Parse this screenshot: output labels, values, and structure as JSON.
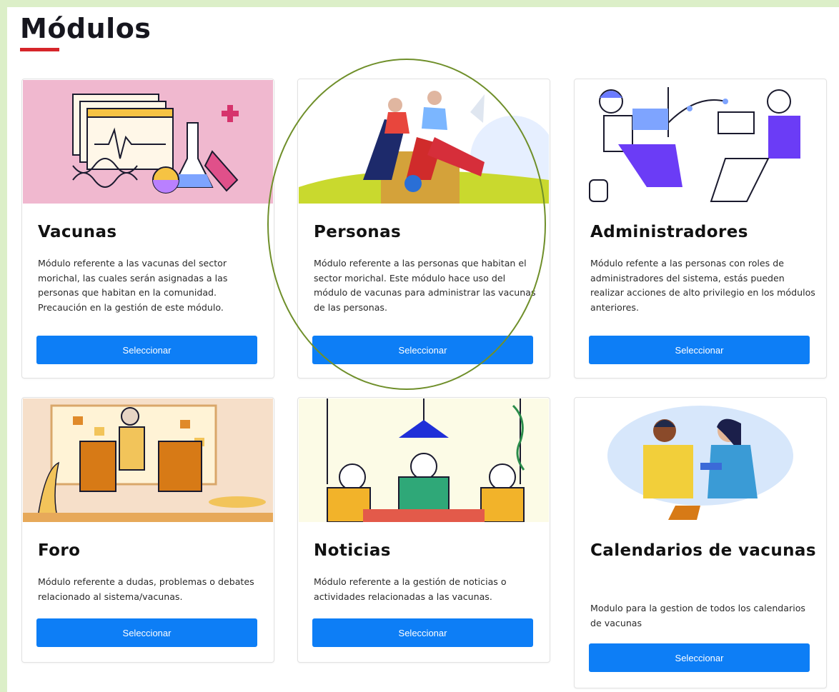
{
  "page": {
    "title": "Módulos"
  },
  "colors": {
    "accent_bar": "#d6252a",
    "button": "#0d7ef6",
    "highlight_circle": "#6f8f2a"
  },
  "cards": [
    {
      "title": "Vacunas",
      "description": "Módulo referente a las vacunas del sector morichal, las cuales serán asignadas a las personas que habitan en la comunidad. Precaución en la gestión de este módulo.",
      "button": "Seleccionar",
      "illustration": "lab-vaccine-illustration"
    },
    {
      "title": "Personas",
      "description": "Módulo referente a las personas que habitan el sector morichal. Este módulo hace uso del módulo de vacunas para administrar las vacunas de las personas.",
      "button": "Seleccionar",
      "illustration": "people-sitting-illustration"
    },
    {
      "title": "Administradores",
      "description": "Módulo refente a las personas con roles de administradores del sistema, estás pueden realizar acciones de alto privilegio en los módulos anteriores.",
      "button": "Seleccionar",
      "illustration": "admins-working-illustration"
    },
    {
      "title": "Foro",
      "description": "Módulo referente a dudas, problemas o debates relacionado al sistema/vacunas.",
      "button": "Seleccionar",
      "illustration": "high-five-illustration"
    },
    {
      "title": "Noticias",
      "description": "Módulo referente a la gestión de noticias o actividades relacionadas a las vacunas.",
      "button": "Seleccionar",
      "illustration": "meeting-table-illustration"
    },
    {
      "title": "Calendarios de vacunas",
      "description": "Modulo para la gestion de todos los calendarios de vacunas",
      "button": "Seleccionar",
      "illustration": "vaccination-illustration"
    }
  ]
}
